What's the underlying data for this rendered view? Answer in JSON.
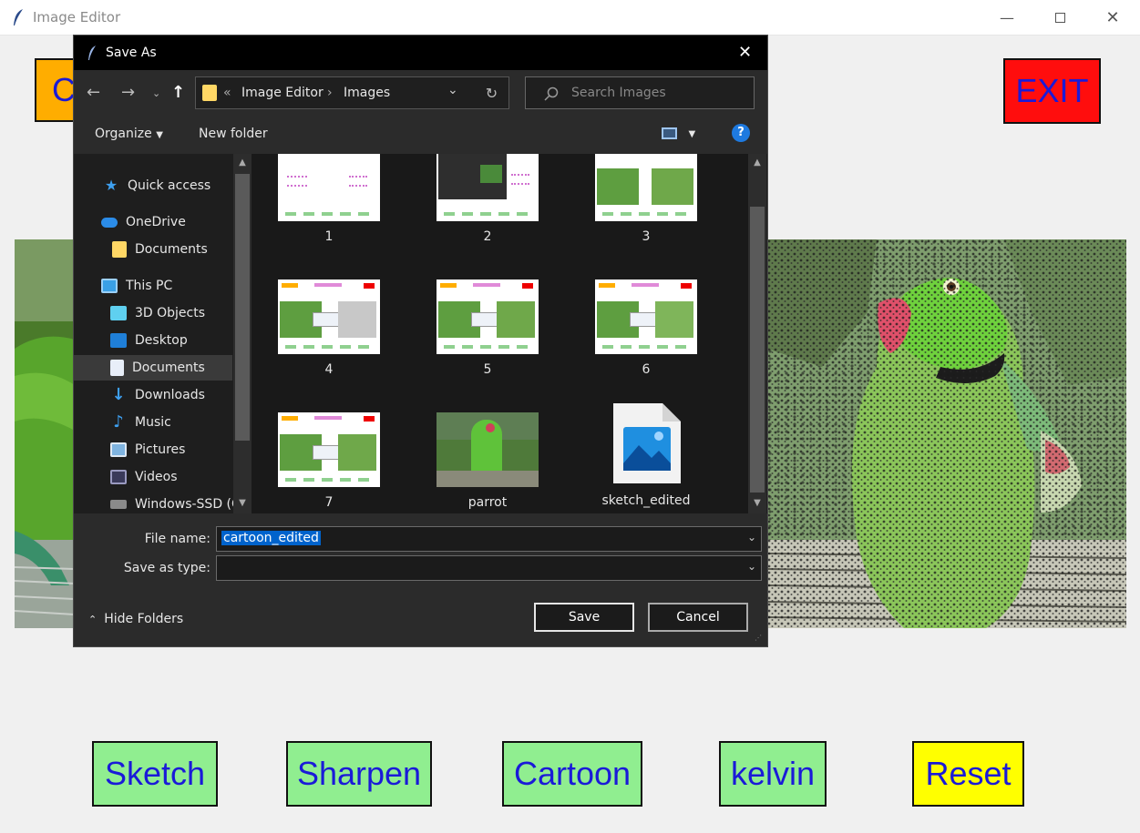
{
  "main_window": {
    "title": "Image Editor",
    "open_button_label": "C",
    "exit_button_label": "EXIT",
    "filter_buttons": {
      "sketch": "Sketch",
      "sharpen": "Sharpen",
      "cartoon": "Cartoon",
      "kelvin": "kelvin",
      "reset": "Reset"
    }
  },
  "dialog": {
    "title": "Save As",
    "breadcrumb": {
      "prefix": "«",
      "parts": [
        "Image Editor",
        "Images"
      ]
    },
    "search_placeholder": "Search Images",
    "toolbar": {
      "organize": "Organize",
      "new_folder": "New folder"
    },
    "sidebar": [
      {
        "label": "Quick access",
        "icon": "star-icon"
      },
      {
        "label": "OneDrive",
        "icon": "cloud-icon"
      },
      {
        "label": "Documents",
        "icon": "folder-icon"
      },
      {
        "label": "This PC",
        "icon": "computer-icon"
      },
      {
        "label": "3D Objects",
        "icon": "cube-icon"
      },
      {
        "label": "Desktop",
        "icon": "desktop-icon"
      },
      {
        "label": "Documents",
        "icon": "document-icon",
        "selected": true
      },
      {
        "label": "Downloads",
        "icon": "download-icon"
      },
      {
        "label": "Music",
        "icon": "music-icon"
      },
      {
        "label": "Pictures",
        "icon": "pictures-icon"
      },
      {
        "label": "Videos",
        "icon": "video-icon"
      },
      {
        "label": "Windows-SSD (C",
        "icon": "drive-icon"
      }
    ],
    "files": [
      {
        "name": "1"
      },
      {
        "name": "2"
      },
      {
        "name": "3"
      },
      {
        "name": "4"
      },
      {
        "name": "5"
      },
      {
        "name": "6"
      },
      {
        "name": "7"
      },
      {
        "name": "parrot"
      },
      {
        "name": "sketch_edited"
      }
    ],
    "file_name_label": "File name:",
    "file_name_value": "cartoon_edited",
    "save_as_type_label": "Save as type:",
    "save_as_type_value": "",
    "hide_folders": "Hide Folders",
    "save_button": "Save",
    "cancel_button": "Cancel"
  },
  "colors": {
    "exit_bg": "#ff0d0d",
    "filter_bg": "#90ee90",
    "reset_bg": "#ffff00",
    "open_bg": "#ffad00",
    "button_text": "#1a1ad8"
  }
}
